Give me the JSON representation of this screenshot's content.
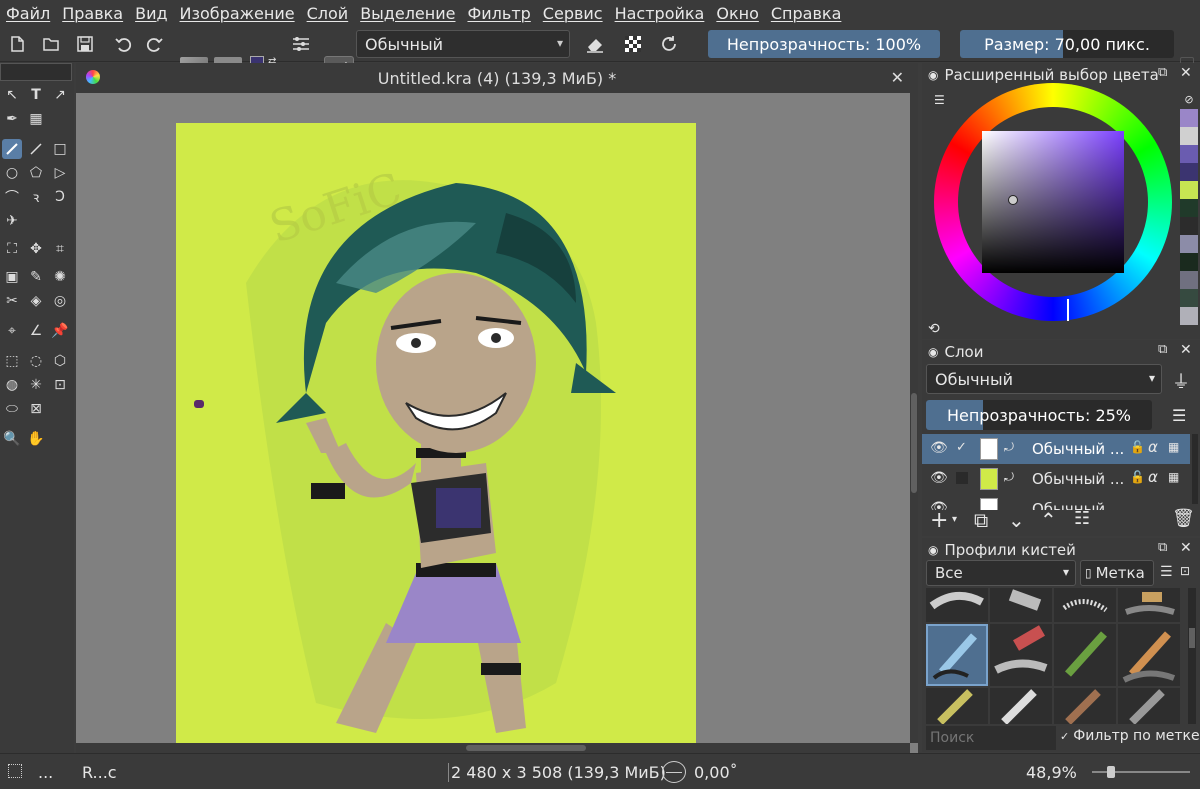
{
  "menu": [
    "Файл",
    "Правка",
    "Вид",
    "Изображение",
    "Слой",
    "Выделение",
    "Фильтр",
    "Сервис",
    "Настройка",
    "Окно",
    "Справка"
  ],
  "toolbar": {
    "blend_mode": "Обычный",
    "opacity_label": "Непрозрачность: 100%",
    "opacity_value": 1.0,
    "size_label": "Размер: 70,00 пикс.",
    "size_fill": 0.48
  },
  "document": {
    "tab_title": "Untitled.kra (4) (139,3 МиБ) *",
    "watermark": "SoFiC"
  },
  "color_panel": {
    "title": "Расширенный выбор цвета",
    "selected_hue": "#7b40ff",
    "palette": [
      "#9a86c8",
      "#d0d0d0",
      "#6a5cb0",
      "#3b3470",
      "#c7e552",
      "#203a2a",
      "#2c2c2c",
      "#8c8ca8",
      "#1a2a1e",
      "#707080",
      "#364a40",
      "#b0b0b8"
    ]
  },
  "layers_panel": {
    "title": "Слои",
    "blend_mode": "Обычный",
    "opacity_label": "Непрозрачность: 25%",
    "opacity_value": 0.25,
    "layers": [
      {
        "name": "Обычный ...",
        "visible": true,
        "selected": true
      },
      {
        "name": "Обычный ...",
        "visible": true,
        "selected": false
      },
      {
        "name": "Обычный ...",
        "visible": true,
        "selected": false
      }
    ]
  },
  "brush_panel": {
    "title": "Профили кистей",
    "filter": "Все",
    "tag_button": "Метка",
    "search_placeholder": "Поиск",
    "filter_by_tag": "Фильтр по метке"
  },
  "status": {
    "left_text": "...",
    "brush_name": "R...c",
    "dimensions": "2 480 x 3 508 (139,3 МиБ)",
    "rotation": "0,00˚",
    "zoom": "48,9%",
    "zoom_value": 0.489
  }
}
